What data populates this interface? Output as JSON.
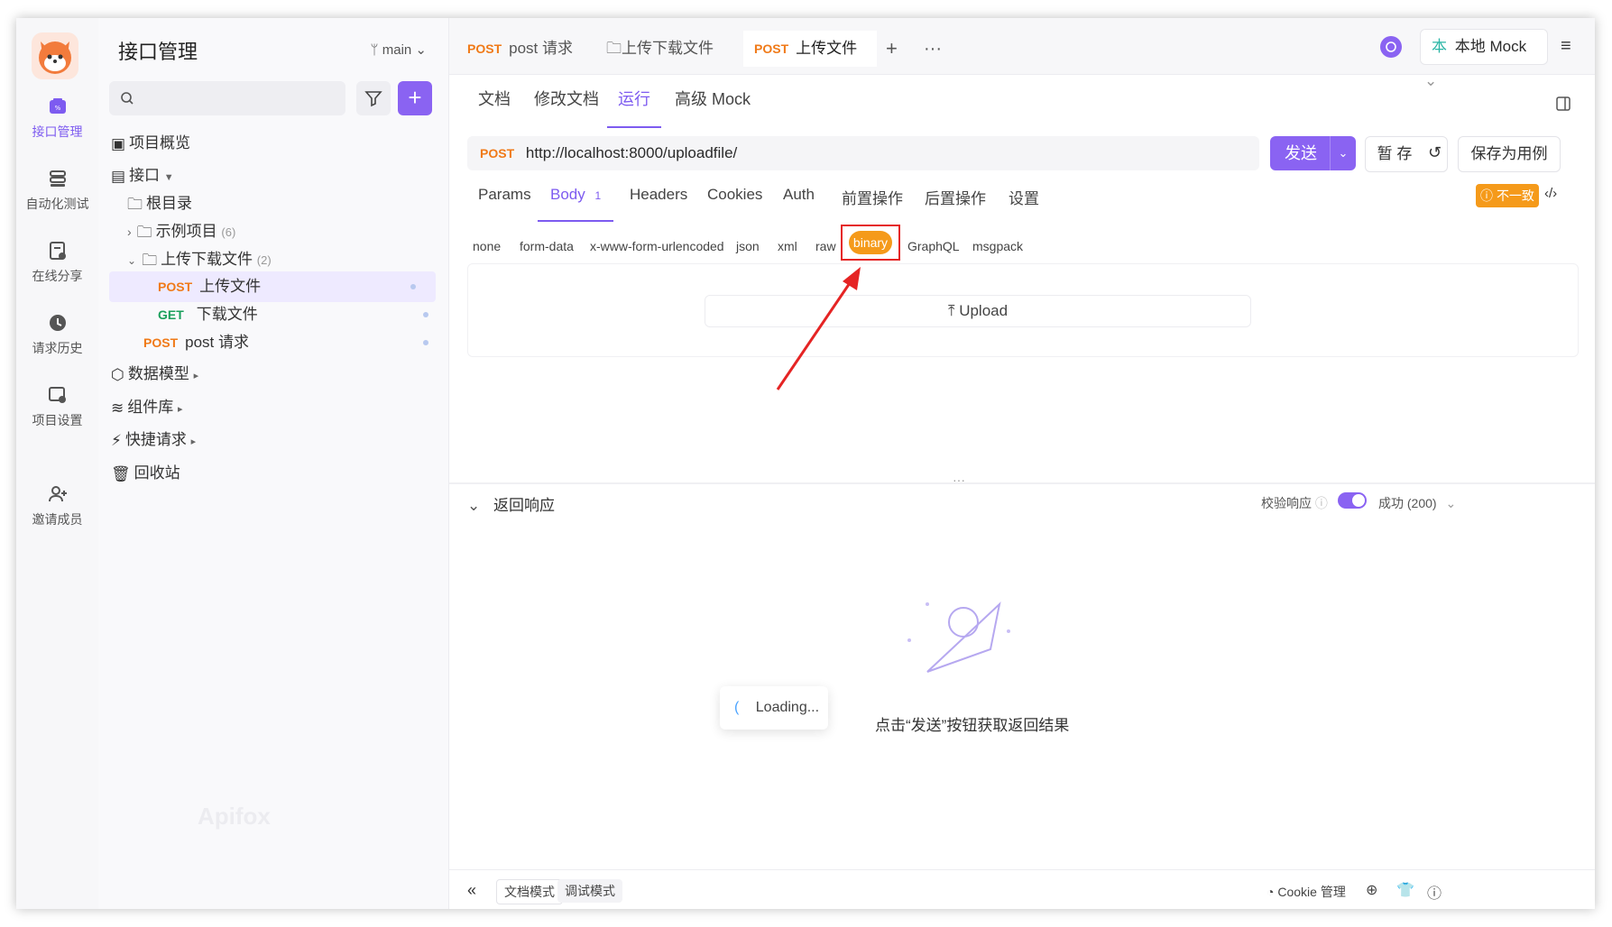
{
  "rail": {
    "items": [
      {
        "label": "接口管理",
        "icon": "api-icon",
        "active": true
      },
      {
        "label": "自动化测试",
        "icon": "test-icon"
      },
      {
        "label": "在线分享",
        "icon": "share-icon"
      },
      {
        "label": "请求历史",
        "icon": "history-icon"
      },
      {
        "label": "项目设置",
        "icon": "settings-icon"
      },
      {
        "label": "邀请成员",
        "icon": "invite-icon"
      }
    ]
  },
  "sidebar": {
    "title": "接口管理",
    "branch": "main",
    "tree": [
      {
        "label": "项目概览"
      },
      {
        "label": "接口"
      },
      {
        "label": "根目录"
      },
      {
        "label": "示例项目",
        "count": "(6)"
      },
      {
        "label": "上传下载文件",
        "count": "(2)"
      },
      {
        "method": "POST",
        "label": "上传文件"
      },
      {
        "method": "GET",
        "label": "下载文件"
      },
      {
        "method": "POST",
        "label": "post 请求"
      },
      {
        "label": "数据模型"
      },
      {
        "label": "组件库"
      },
      {
        "label": "快捷请求"
      },
      {
        "label": "回收站"
      }
    ],
    "watermark": "Apifox"
  },
  "tabs": [
    {
      "method": "POST",
      "label": "post 请求"
    },
    {
      "label": "上传下载文件"
    },
    {
      "method": "POST",
      "label": "上传文件",
      "active": true
    }
  ],
  "env": {
    "label": "本地 Mock"
  },
  "subtabs": [
    "文档",
    "修改文档",
    "运行",
    "高级 Mock"
  ],
  "request": {
    "method": "POST",
    "url": "http://localhost:8000/uploadfile/",
    "send": "发送",
    "temp_save": "暂 存",
    "save_case": "保存为用例"
  },
  "param_tabs": [
    {
      "label": "Params"
    },
    {
      "label": "Body",
      "badge": "1",
      "active": true
    },
    {
      "label": "Headers"
    },
    {
      "label": "Cookies"
    },
    {
      "label": "Auth"
    },
    {
      "label": "前置操作"
    },
    {
      "label": "后置操作"
    },
    {
      "label": "设置"
    }
  ],
  "mismatch_badge": "不一致",
  "body_types": [
    "none",
    "form-data",
    "x-www-form-urlencoded",
    "json",
    "xml",
    "raw",
    "binary",
    "GraphQL",
    "msgpack"
  ],
  "upload": {
    "label": "Upload"
  },
  "response": {
    "title": "返回响应",
    "validate": "校验响应",
    "status": "成功 (200)",
    "empty_text": "点击“发送”按钮获取返回结果",
    "loading": "Loading..."
  },
  "bottom": {
    "doc_mode": "文档模式",
    "debug_mode": "调试模式",
    "cookie": "Cookie 管理"
  },
  "colors": {
    "accent": "#8a63f2",
    "post": "#f07a18",
    "get": "#1aa05c",
    "binary": "#f59a1a",
    "highlight": "#e52424"
  }
}
